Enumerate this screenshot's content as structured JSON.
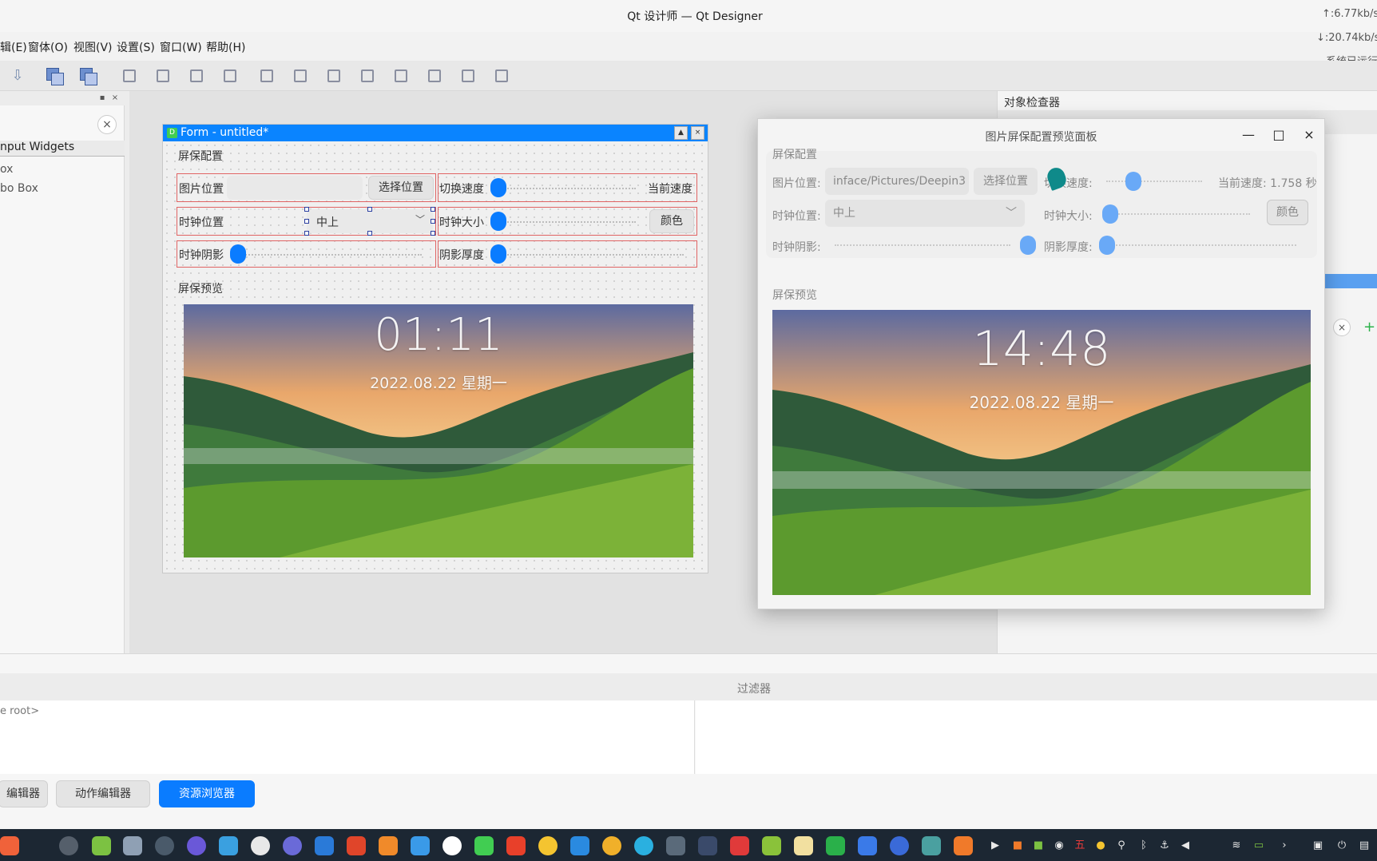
{
  "window": {
    "title": "Qt 设计师 — Qt Designer",
    "net_up": "↑:6.77kb/s",
    "net_down": "↓:20.74kb/s",
    "sys_status": "系统已运行"
  },
  "menubar": {
    "items": [
      "辑(E)",
      "窗体(O)",
      "视图(V)",
      "设置(S)",
      "窗口(W)",
      "帮助(H)"
    ]
  },
  "left_dock": {
    "clear_icon": "close-icon",
    "group_title": "nput Widgets",
    "items": [
      "ox",
      "bo Box"
    ]
  },
  "form_window": {
    "title": "Form - untitled*",
    "group_config_title": "屏保配置",
    "image_pos_label": "图片位置",
    "choose_pos_button": "选择位置",
    "switch_speed_label": "切换速度",
    "current_speed_label": "当前速度",
    "clock_pos_label": "时钟位置",
    "clock_pos_value": "中上",
    "clock_size_label": "时钟大小",
    "color_button": "颜色",
    "clock_shadow_label": "时钟阴影",
    "shadow_thickness_label": "阴影厚度",
    "group_preview_title": "屏保预览",
    "preview_time": "01:11",
    "preview_date": "2022.08.22 星期一"
  },
  "preview_dialog": {
    "title": "图片屏保配置预览面板",
    "group_config_title": "屏保配置",
    "image_pos_label": "图片位置:",
    "image_pos_value": "inface/Pictures/Deepin3",
    "choose_pos_button": "选择位置",
    "switch_speed_label": "切换速度:",
    "current_speed_text": "当前速度: 1.758 秒",
    "clock_pos_label": "时钟位置:",
    "clock_pos_value": "中上",
    "clock_size_label": "时钟大小:",
    "color_button": "颜色",
    "clock_shadow_label": "时钟阴影:",
    "shadow_thickness_label": "阴影厚度:",
    "group_preview_title": "屏保预览",
    "preview_time": "14:48",
    "preview_date": "2022.08.22 星期一"
  },
  "right_dock": {
    "title": "对象检查器"
  },
  "bottom": {
    "filter_label": "过滤器",
    "root_label": "e root>",
    "tabs": [
      "编辑器",
      "动作编辑器",
      "资源浏览器"
    ],
    "active_tab": "资源浏览器"
  },
  "colors": {
    "accent": "#0a7cff",
    "form_titlebar": "#0a84ff",
    "red_layout": "#e06464",
    "taskbar": "#1c2733"
  }
}
